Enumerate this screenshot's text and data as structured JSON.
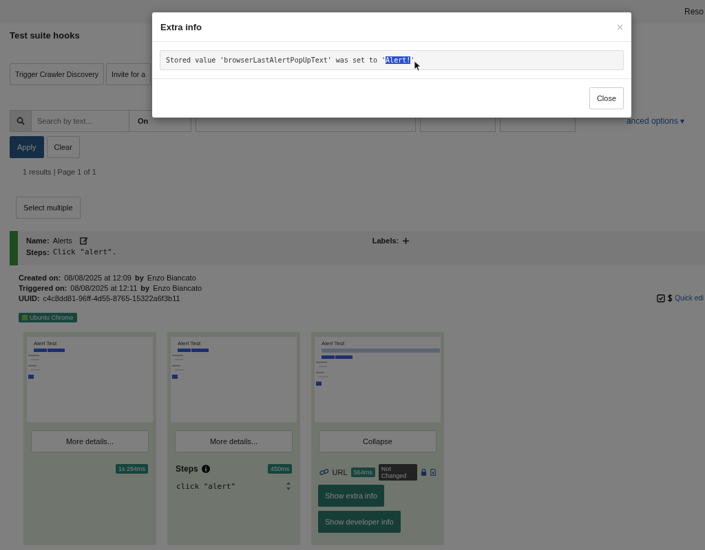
{
  "topbar": {
    "link": "Reso"
  },
  "title": "Test suite hooks",
  "actions": [
    "Trigger Crawler Discovery",
    "Invite for a"
  ],
  "filters": {
    "search_placeholder": "Search by text...",
    "select": "On",
    "advanced": "anced options ▾"
  },
  "filter_buttons": [
    {
      "label": "Apply",
      "kind": "primary"
    },
    {
      "label": "Clear",
      "kind": "plain"
    }
  ],
  "results": "1 results | Page 1 of 1",
  "select_multiple": "Select multiple",
  "test": {
    "name_label": "Name:",
    "name": "Alerts",
    "labels_label": "Labels:",
    "steps_label": "Steps:",
    "steps": "Click \"alert\".",
    "created_label": "Created on:",
    "created": "08/08/2025 at 12:09",
    "created_by_label": "by",
    "created_by": "Enzo Biancato",
    "triggered_label": "Triggered on:",
    "triggered": "08/08/2025 at 12:11",
    "triggered_by_label": "by",
    "triggered_by": "Enzo Biancato",
    "uuid_label": "UUID:",
    "uuid": "c4c8dd81-96ff-4d55-8765-15322a6f3b11",
    "quick_edit": "Quick edi",
    "tag": "Ubuntu Chrome"
  },
  "cards": [
    {
      "kind": "basic",
      "thumb_title": "Alert Test",
      "thumb_banner": false,
      "button": "More details...",
      "time": "1s 294ms"
    },
    {
      "kind": "steps",
      "thumb_title": "Alert Test",
      "thumb_banner": false,
      "button": "More details...",
      "steps_title": "Steps",
      "time": "450ms",
      "code": "click \"alert\""
    },
    {
      "kind": "expanded",
      "thumb_title": "Alert Test",
      "thumb_banner": true,
      "button": "Collapse",
      "url": "URL",
      "time": "564ms",
      "status": "Not Changed",
      "extra_button": "Show extra info",
      "dev_button": "Show developer info"
    }
  ],
  "modal": {
    "title": "Extra info",
    "message": [
      {
        "text": "Stored value 'browserLastAlertPopUpText' was set to '",
        "selected": false
      },
      {
        "text": "Alert!",
        "selected": true
      },
      {
        "text": "'",
        "selected": false
      }
    ],
    "close": "Close"
  }
}
